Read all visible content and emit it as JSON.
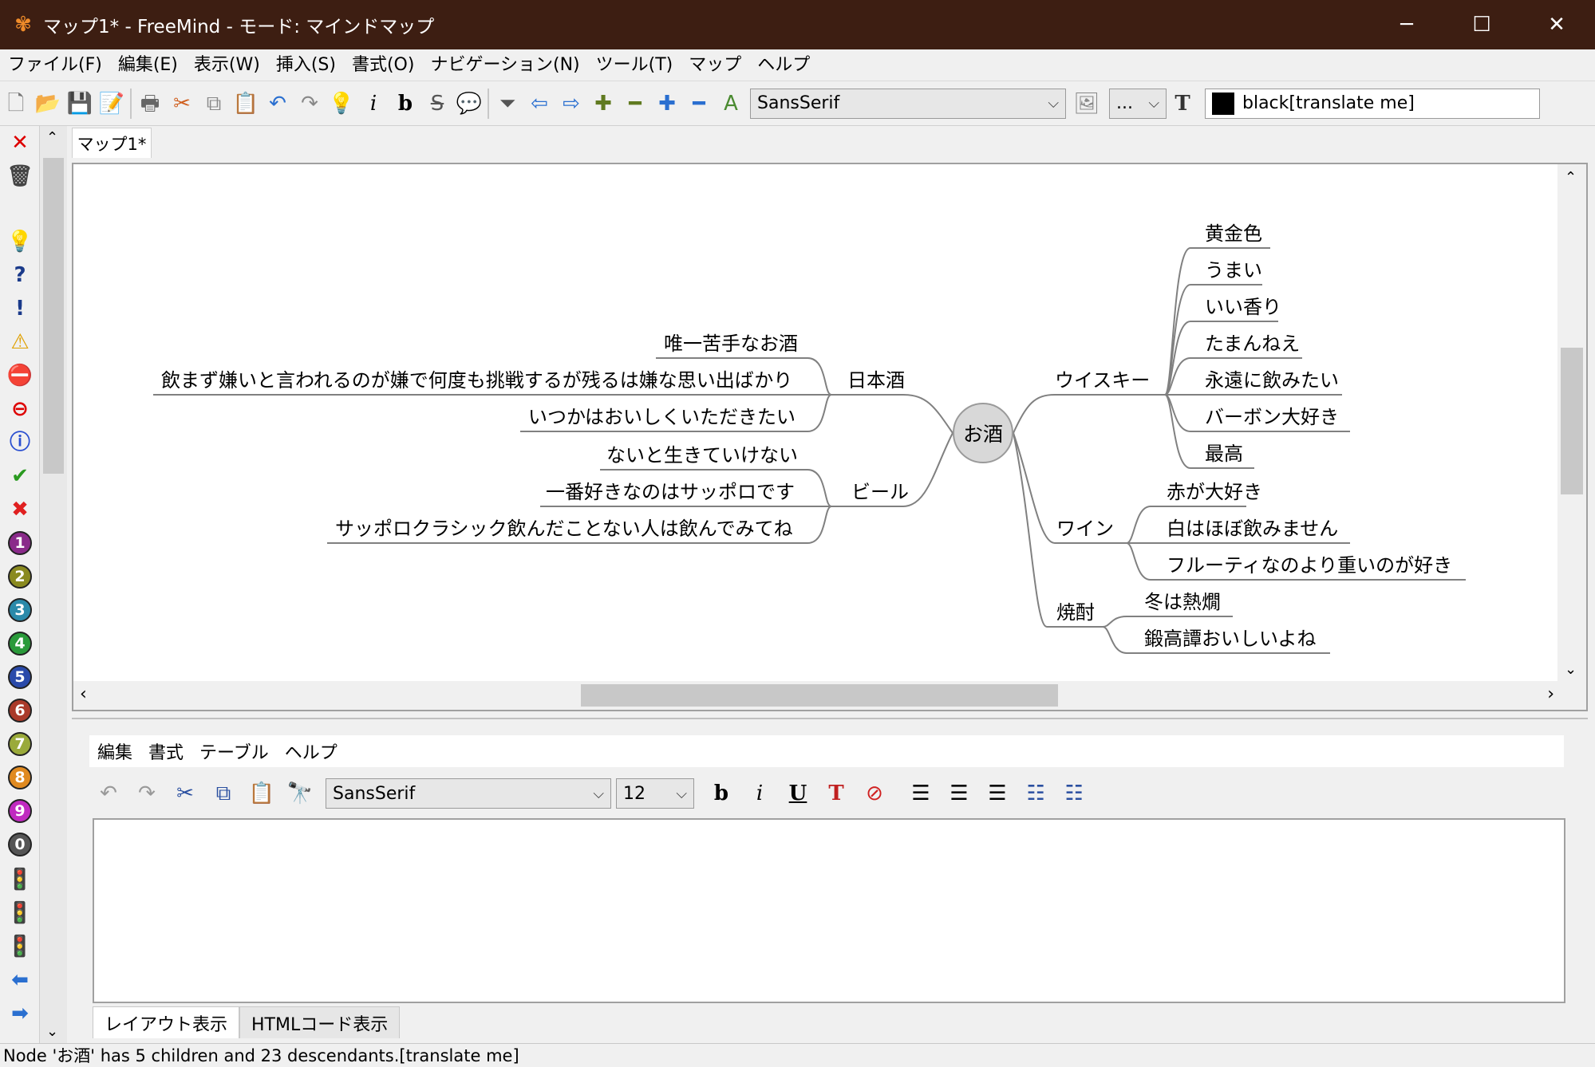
{
  "window": {
    "title": "マップ1* - FreeMind - モード: マインドマップ",
    "minimize": "─",
    "maximize": "☐",
    "close": "✕"
  },
  "menubar": [
    "ファイル(F)",
    "編集(E)",
    "表示(W)",
    "挿入(S)",
    "書式(O)",
    "ナビゲーション(N)",
    "ツール(T)",
    "マップ",
    "ヘルプ"
  ],
  "toolbar": {
    "font": "SansSerif",
    "size": "...",
    "color_name": "black[translate me]"
  },
  "tab": {
    "label": "マップ1*"
  },
  "mindmap": {
    "root": "お酒",
    "left": {
      "nihonshu": {
        "label": "日本酒",
        "children": [
          "唯一苦手なお酒",
          "飲まず嫌いと言われるのが嫌で何度も挑戦するが残るは嫌な思い出ばかり",
          "いつかはおいしくいただきたい"
        ]
      },
      "beer": {
        "label": "ビール",
        "children": [
          "ないと生きていけない",
          "一番好きなのはサッポロです",
          "サッポロクラシック飲んだことない人は飲んでみてね"
        ]
      }
    },
    "right": {
      "whisky": {
        "label": "ウイスキー",
        "children": [
          "黄金色",
          "うまい",
          "いい香り",
          "たまんねえ",
          "永遠に飲みたい",
          "バーボン大好き",
          "最高"
        ]
      },
      "wine": {
        "label": "ワイン",
        "children": [
          "赤が大好き",
          "白はほぼ飲みません",
          "フルーティなのより重いのが好き"
        ]
      },
      "shochu": {
        "label": "焼酎",
        "children": [
          "冬は熱燗",
          "鍛高譚おいしいよね"
        ]
      }
    }
  },
  "note_editor": {
    "menus": [
      "編集",
      "書式",
      "テーブル",
      "ヘルプ"
    ],
    "font": "SansSerif",
    "size": "12",
    "tabs": [
      "レイアウト表示",
      "HTMLコード表示"
    ]
  },
  "status": "Node 'お酒' has 5 children and 23 descendants.[translate me]",
  "colors": {
    "titlebar": "#3d1e12",
    "edge": "#808080"
  }
}
